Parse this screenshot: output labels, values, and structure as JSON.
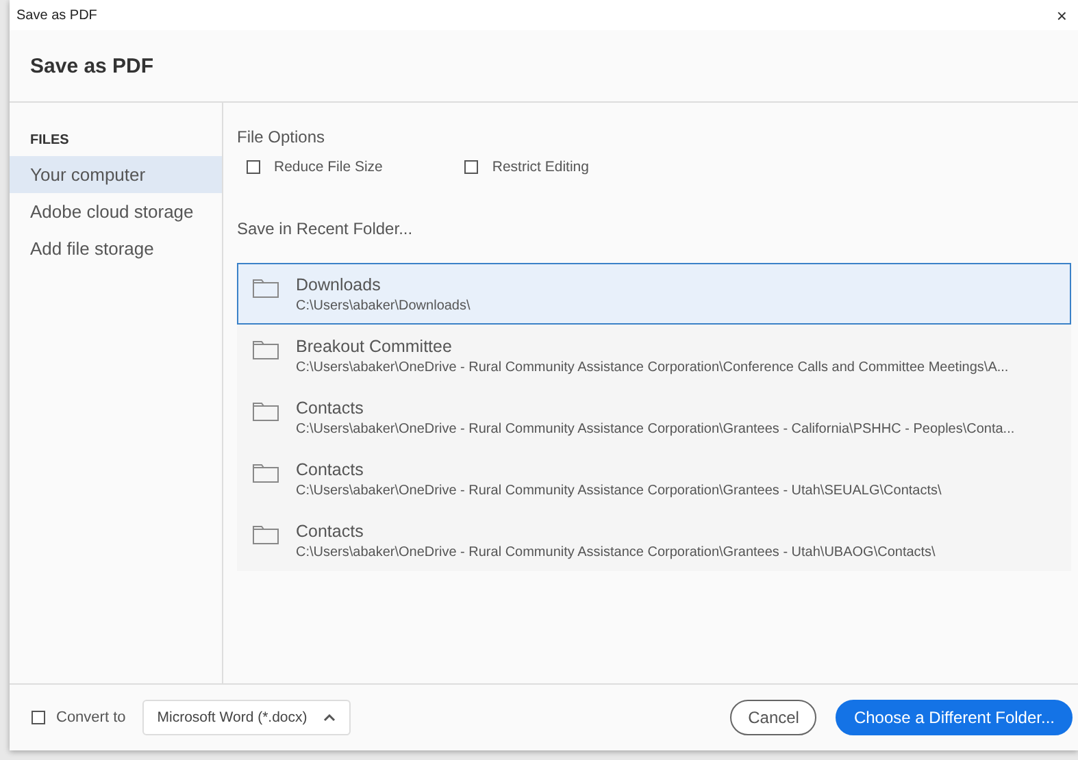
{
  "window": {
    "title": "Save as PDF",
    "close": "×"
  },
  "header": {
    "title": "Save as PDF"
  },
  "sidebar": {
    "heading": "FILES",
    "items": [
      {
        "label": "Your computer",
        "selected": true
      },
      {
        "label": "Adobe cloud storage",
        "selected": false
      },
      {
        "label": "Add file storage",
        "selected": false
      }
    ]
  },
  "file_options": {
    "heading": "File Options",
    "options": [
      {
        "label": "Reduce File Size",
        "checked": false
      },
      {
        "label": "Restrict Editing",
        "checked": false
      }
    ]
  },
  "recent": {
    "heading": "Save in Recent Folder...",
    "folders": [
      {
        "name": "Downloads",
        "path": "C:\\Users\\abaker\\Downloads\\",
        "selected": true
      },
      {
        "name": "Breakout Committee",
        "path": "C:\\Users\\abaker\\OneDrive - Rural Community Assistance Corporation\\Conference Calls and Committee Meetings\\A...",
        "selected": false
      },
      {
        "name": "Contacts",
        "path": "C:\\Users\\abaker\\OneDrive - Rural Community Assistance Corporation\\Grantees - California\\PSHHC - Peoples\\Conta...",
        "selected": false
      },
      {
        "name": "Contacts",
        "path": "C:\\Users\\abaker\\OneDrive - Rural Community Assistance Corporation\\Grantees - Utah\\SEUALG\\Contacts\\",
        "selected": false
      },
      {
        "name": "Contacts",
        "path": "C:\\Users\\abaker\\OneDrive - Rural Community Assistance Corporation\\Grantees - Utah\\UBAOG\\Contacts\\",
        "selected": false
      }
    ]
  },
  "footer": {
    "convert": {
      "label": "Convert to",
      "checked": false,
      "format": "Microsoft Word (*.docx)"
    },
    "buttons": [
      {
        "label": "Cancel",
        "kind": "secondary"
      },
      {
        "label": "Choose a Different Folder...",
        "kind": "primary"
      }
    ]
  }
}
